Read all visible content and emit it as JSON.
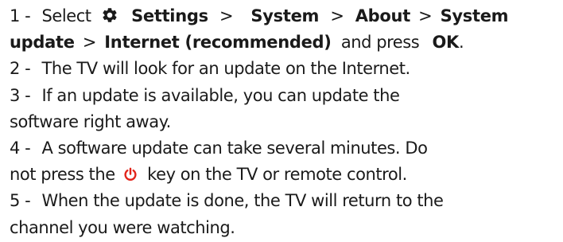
{
  "steps": [
    {
      "number": "1 -",
      "select": "Select",
      "settings": "Settings",
      "gt1": ">",
      "system": "System",
      "gt2": ">",
      "about": "About",
      "gt3": ">",
      "system_update_1": "System",
      "system_update_2": "update",
      "gt4": ">",
      "internet": "Internet (recommended)",
      "and_press": "and press",
      "ok": "OK",
      "period": "."
    },
    {
      "number": "2 -",
      "text": "The TV will look for an update on the Internet."
    },
    {
      "number": "3 -",
      "text_line1": "If an update is available, you can update the",
      "text_line2": "software right away."
    },
    {
      "number": "4 -",
      "text_line1": "A software update can take several minutes. Do",
      "text_line2_a": "not press the",
      "text_line2_b": "key on the TV or remote control."
    },
    {
      "number": "5 -",
      "text_line1": "When the update is done, the TV will return to the",
      "text_line2": "channel you were watching."
    }
  ],
  "icons": {
    "settings": "gear-icon",
    "power": "power-icon"
  },
  "colors": {
    "text": "#1a1a1a",
    "power_icon": "#e2231a"
  }
}
